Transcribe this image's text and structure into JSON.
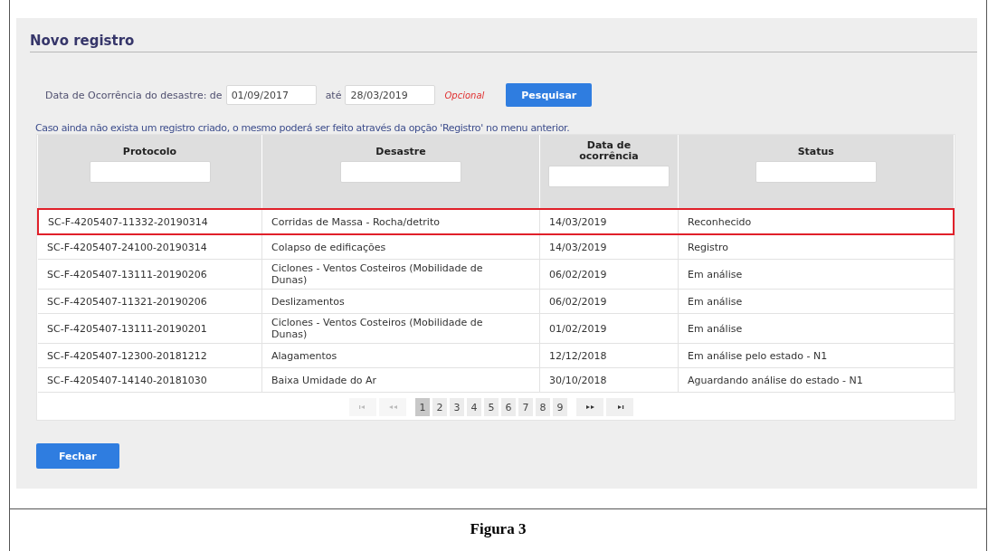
{
  "panel": {
    "title": "Novo registro"
  },
  "filter": {
    "label": "Data de Ocorrência do desastre: de",
    "from": "01/09/2017",
    "to_label": "até",
    "to": "28/03/2019",
    "hint": "Opcional",
    "button": "Pesquisar"
  },
  "info": "Caso ainda não exista um registro criado, o mesmo poderá ser feito através da opção 'Registro' no menu anterior.",
  "table": {
    "columns": [
      "Protocolo",
      "Desastre",
      "Data de ocorrência",
      "Status"
    ],
    "rows": [
      {
        "cells": [
          "SC-F-4205407-11332-20190314",
          "Corridas de Massa - Rocha/detrito",
          "14/03/2019",
          "Reconhecido"
        ],
        "selected": true
      },
      {
        "cells": [
          "SC-F-4205407-24100-20190314",
          "Colapso de edificações",
          "14/03/2019",
          "Registro"
        ],
        "selected": false
      },
      {
        "cells": [
          "SC-F-4205407-13111-20190206",
          "Ciclones - Ventos Costeiros (Mobilidade de Dunas)",
          "06/02/2019",
          "Em análise"
        ],
        "selected": false
      },
      {
        "cells": [
          "SC-F-4205407-11321-20190206",
          "Deslizamentos",
          "06/02/2019",
          "Em análise"
        ],
        "selected": false
      },
      {
        "cells": [
          "SC-F-4205407-13111-20190201",
          "Ciclones - Ventos Costeiros (Mobilidade de Dunas)",
          "01/02/2019",
          "Em análise"
        ],
        "selected": false
      },
      {
        "cells": [
          "SC-F-4205407-12300-20181212",
          "Alagamentos",
          "12/12/2018",
          "Em análise pelo estado - N1"
        ],
        "selected": false
      },
      {
        "cells": [
          "SC-F-4205407-14140-20181030",
          "Baixa Umidade do Ar",
          "30/10/2018",
          "Aguardando análise do estado - N1"
        ],
        "selected": false
      }
    ]
  },
  "pager": {
    "before": [
      {
        "kind": "first",
        "disabled": true
      },
      {
        "kind": "prev",
        "disabled": true
      }
    ],
    "pages": [
      {
        "label": "1",
        "selected": true
      },
      {
        "label": "2",
        "selected": false
      },
      {
        "label": "3",
        "selected": false
      },
      {
        "label": "4",
        "selected": false
      },
      {
        "label": "5",
        "selected": false
      },
      {
        "label": "6",
        "selected": false
      },
      {
        "label": "7",
        "selected": false
      },
      {
        "label": "8",
        "selected": false
      },
      {
        "label": "9",
        "selected": false
      }
    ],
    "after": [
      {
        "kind": "next",
        "disabled": false
      },
      {
        "kind": "last",
        "disabled": false
      }
    ]
  },
  "close_button": "Fechar",
  "caption": "Figura 3"
}
